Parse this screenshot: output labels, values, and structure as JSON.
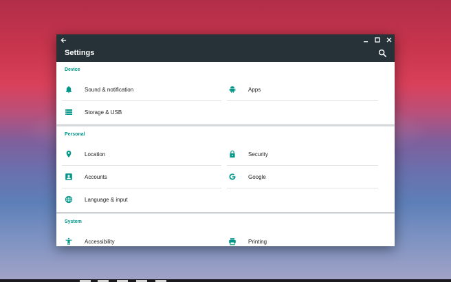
{
  "window": {
    "title": "Settings",
    "controls": [
      "back",
      "minimize",
      "maximize",
      "close"
    ]
  },
  "sections": [
    {
      "header": "Device",
      "items": [
        {
          "label": "Sound & notification",
          "icon": "bell-icon"
        },
        {
          "label": "Apps",
          "icon": "android-icon"
        },
        {
          "label": "Storage & USB",
          "icon": "storage-icon"
        }
      ]
    },
    {
      "header": "Personal",
      "items": [
        {
          "label": "Location",
          "icon": "location-pin-icon"
        },
        {
          "label": "Security",
          "icon": "lock-icon"
        },
        {
          "label": "Accounts",
          "icon": "account-box-icon"
        },
        {
          "label": "Google",
          "icon": "google-icon"
        },
        {
          "label": "Language & input",
          "icon": "globe-icon"
        }
      ]
    },
    {
      "header": "System",
      "items": [
        {
          "label": "Accessibility",
          "icon": "accessibility-icon"
        },
        {
          "label": "Printing",
          "icon": "printer-icon"
        }
      ]
    }
  ],
  "colors": {
    "toolbar": "#263238",
    "section_header": "#009688",
    "icon": "#009688",
    "background": "#eceff1"
  }
}
